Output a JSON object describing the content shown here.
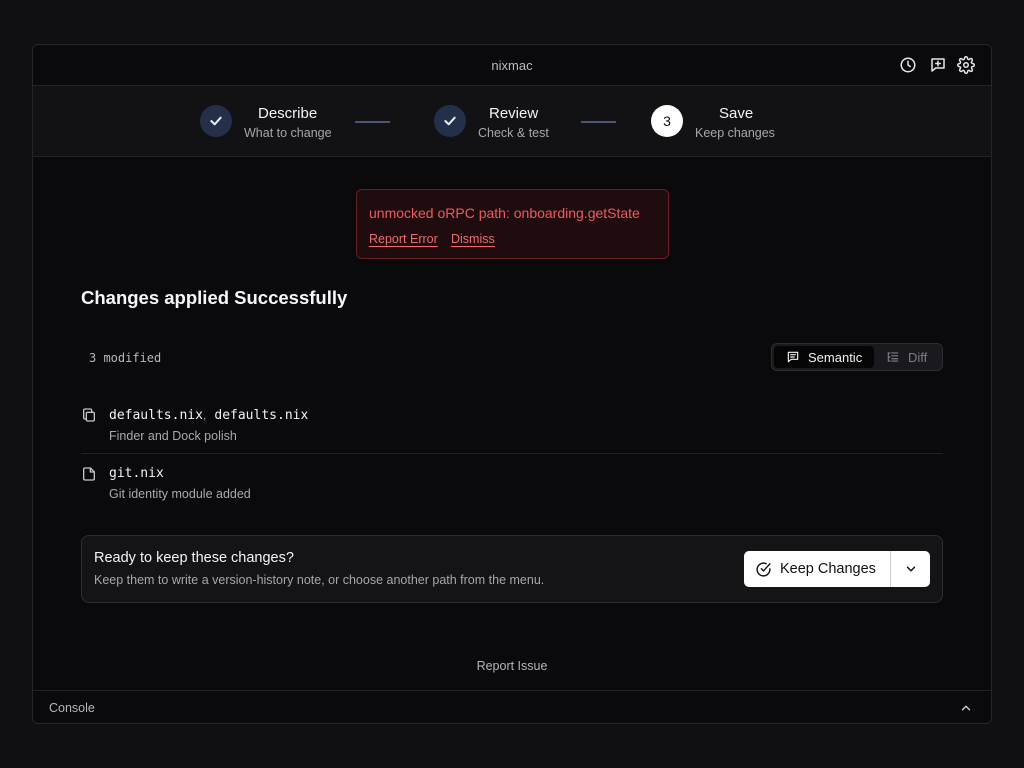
{
  "app": {
    "title": "nixmac"
  },
  "toolbar": {
    "icons": [
      "history-icon",
      "feedback-icon",
      "settings-icon"
    ]
  },
  "steps": [
    {
      "number": "1",
      "title": "Describe",
      "subtitle": "What to change",
      "state": "done"
    },
    {
      "number": "2",
      "title": "Review",
      "subtitle": "Check & test",
      "state": "done"
    },
    {
      "number": "3",
      "title": "Save",
      "subtitle": "Keep changes",
      "state": "active"
    }
  ],
  "error": {
    "message": "unmocked oRPC path: onboarding.getState",
    "report_label": "Report Error",
    "dismiss_label": "Dismiss",
    "color": "#ef5a5f"
  },
  "main": {
    "heading": "Changes applied Successfully",
    "modified_count": "3 modified"
  },
  "view_toggle": {
    "semantic_label": "Semantic",
    "diff_label": "Diff",
    "selected": "Semantic"
  },
  "files": [
    {
      "names": [
        "defaults.nix",
        "defaults.nix"
      ],
      "separator": ",",
      "description": "Finder and Dock polish",
      "icon": "files-icon"
    },
    {
      "names": [
        "git.nix"
      ],
      "separator": "",
      "description": "Git identity module added",
      "icon": "file-icon"
    }
  ],
  "keep_card": {
    "title": "Ready to keep these changes?",
    "subtitle": "Keep them to write a version-history note, or choose another path from the menu.",
    "button_label": "Keep Changes"
  },
  "footer": {
    "report_issue": "Report Issue"
  },
  "console": {
    "label": "Console"
  }
}
